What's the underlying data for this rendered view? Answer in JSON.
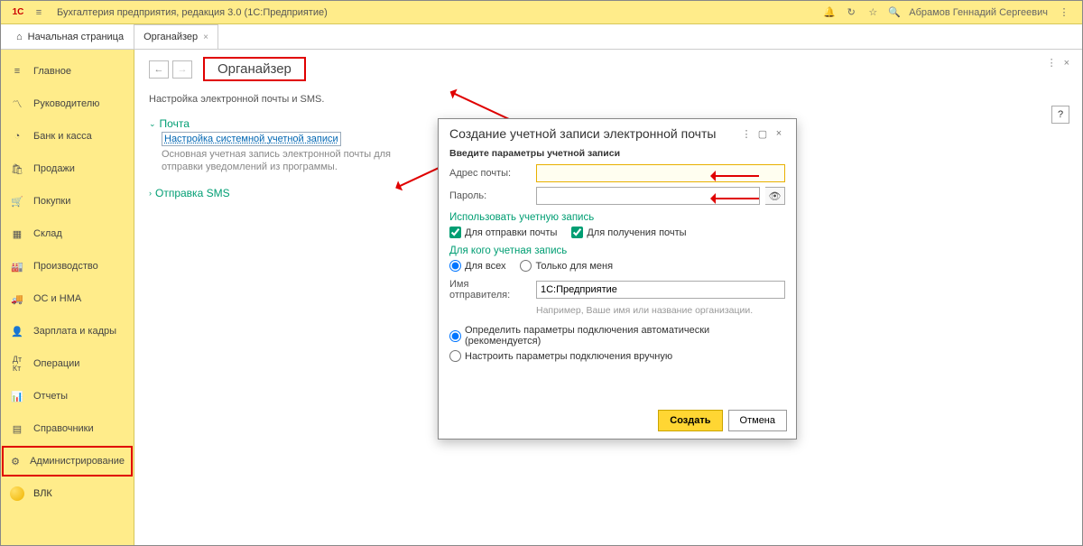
{
  "topbar": {
    "logo_text": "1C",
    "title": "Бухгалтерия предприятия, редакция 3.0  (1С:Предприятие)",
    "user_name": "Абрамов Геннадий Сергеевич"
  },
  "tabs": {
    "home": "Начальная страница",
    "organizer": "Органайзер"
  },
  "sidebar": {
    "items": [
      {
        "key": "main",
        "label": "Главное"
      },
      {
        "key": "leader",
        "label": "Руководителю"
      },
      {
        "key": "bank",
        "label": "Банк и касса"
      },
      {
        "key": "sales",
        "label": "Продажи"
      },
      {
        "key": "purchases",
        "label": "Покупки"
      },
      {
        "key": "warehouse",
        "label": "Склад"
      },
      {
        "key": "production",
        "label": "Производство"
      },
      {
        "key": "os",
        "label": "ОС и НМА"
      },
      {
        "key": "salary",
        "label": "Зарплата и кадры"
      },
      {
        "key": "operations",
        "label": "Операции"
      },
      {
        "key": "reports",
        "label": "Отчеты"
      },
      {
        "key": "refs",
        "label": "Справочники"
      },
      {
        "key": "admin",
        "label": "Администрирование"
      },
      {
        "key": "vlk",
        "label": "ВЛК"
      }
    ]
  },
  "page": {
    "title": "Органайзер",
    "subtitle": "Настройка электронной почты и SMS.",
    "section_mail": "Почта",
    "link_account": "Настройка системной учетной записи",
    "hint": "Основная учетная запись электронной почты для отправки уведомлений из программы.",
    "section_sms": "Отправка SMS",
    "help": "?"
  },
  "modal": {
    "title": "Создание учетной записи электронной почты",
    "params_title": "Введите параметры учетной записи",
    "addr_label": "Адрес почты:",
    "addr_value": "",
    "pwd_label": "Пароль:",
    "pwd_value": "",
    "use_title": "Использовать учетную запись",
    "chk_send": "Для отправки почты",
    "chk_recv": "Для получения почты",
    "for_title": "Для кого учетная запись",
    "radio_all": "Для всех",
    "radio_me": "Только для меня",
    "sender_label": "Имя отправителя:",
    "sender_value": "1С:Предприятие",
    "sender_hint": "Например, Ваше имя или название организации.",
    "auto_label": "Определить параметры подключения автоматически (рекомендуется)",
    "manual_label": "Настроить параметры подключения вручную",
    "btn_create": "Создать",
    "btn_cancel": "Отмена"
  }
}
